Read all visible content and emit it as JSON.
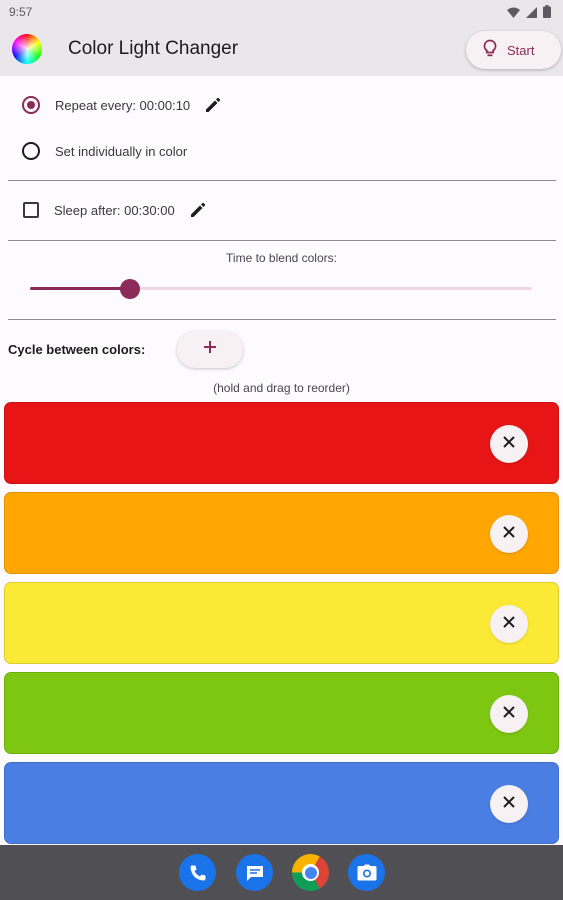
{
  "status_bar": {
    "time": "9:57",
    "icons": [
      "wifi-icon",
      "signal-icon",
      "battery-icon"
    ]
  },
  "app_bar": {
    "title": "Color Light Changer",
    "logo": "color-wheel-icon",
    "start_label": "Start",
    "start_icon": "lightbulb-icon"
  },
  "options": {
    "repeat_label": "Repeat every: 00:00:10",
    "repeat_selected": true,
    "individual_label": "Set individually in color",
    "individual_selected": false,
    "sleep_label": "Sleep after: 00:30:00",
    "sleep_checked": false
  },
  "blend": {
    "label": "Time to blend colors:",
    "value_fraction": 0.2
  },
  "cycle": {
    "label": "Cycle between colors:",
    "add_icon": "plus-icon",
    "hint": "(hold and drag to reorder)"
  },
  "colors": [
    {
      "name": "red",
      "hex": "#e71515"
    },
    {
      "name": "orange",
      "hex": "#ffa600"
    },
    {
      "name": "yellow",
      "hex": "#faea35"
    },
    {
      "name": "green",
      "hex": "#7dc611"
    },
    {
      "name": "blue",
      "hex": "#4a7ee3"
    }
  ],
  "accent": "#8b2b5a",
  "dock": [
    "phone-icon",
    "messages-icon",
    "chrome-icon",
    "camera-icon"
  ]
}
